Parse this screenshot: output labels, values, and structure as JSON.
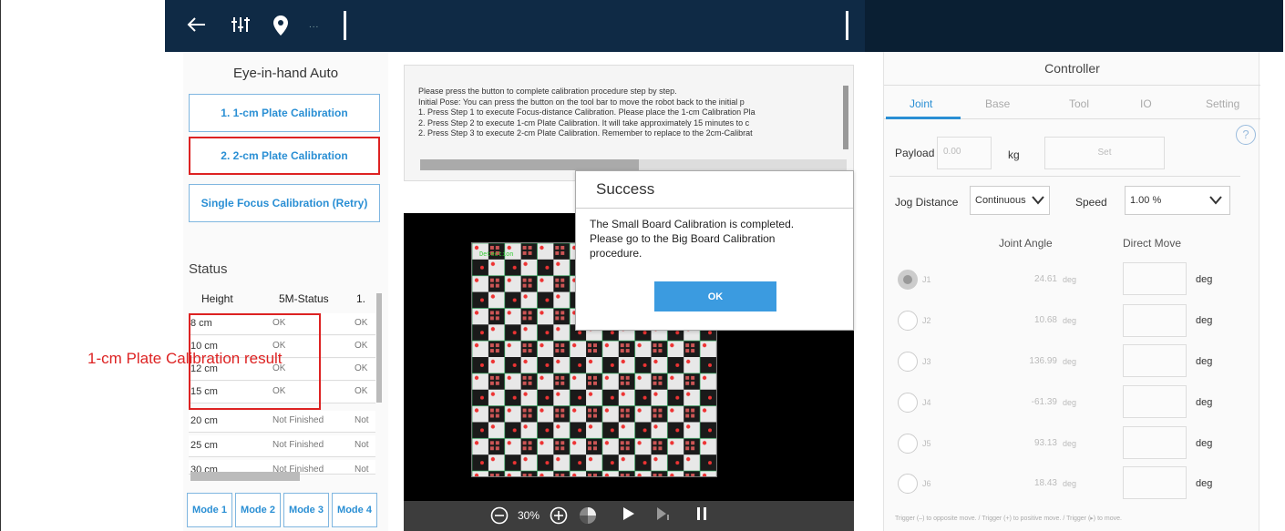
{
  "toolbar": {
    "back_icon": "arrow-left-icon",
    "sliders_icon": "sliders-icon",
    "pin_icon": "location-pin-icon",
    "ellipsis": "..."
  },
  "left": {
    "title": "Eye-in-hand Auto",
    "buttons": [
      "1. 1-cm Plate Calibration",
      "2. 2-cm Plate Calibration",
      "Single Focus Calibration (Retry)"
    ],
    "status_label": "Status",
    "columns": [
      "Height",
      "5M-Status",
      "1."
    ],
    "rows": [
      {
        "height": "8 cm",
        "status": "OK",
        "c3": "OK"
      },
      {
        "height": "10 cm",
        "status": "OK",
        "c3": "OK"
      },
      {
        "height": "12 cm",
        "status": "OK",
        "c3": "OK"
      },
      {
        "height": "15 cm",
        "status": "OK",
        "c3": "OK"
      },
      {
        "height": "20 cm",
        "status": "Not Finished",
        "c3": "Not"
      },
      {
        "height": "25 cm",
        "status": "Not Finished",
        "c3": "Not"
      },
      {
        "height": "30 cm",
        "status": "Not Finished",
        "c3": "Not"
      }
    ],
    "modes": [
      "Mode 1",
      "Mode 2",
      "Mode 3",
      "Mode 4"
    ]
  },
  "annotation": "1-cm Plate Calibration result",
  "instructions": [
    "Please press the button to complete calibration procedure step by step.",
    "Initial Pose: You can press the button on the tool bar to move the robot back to the initial p",
    "1. Press Step 1 to execute Focus-distance Calibration. Please place the 1-cm Calibration Pla",
    "2. Press Step 2 to execute 1-cm Plate Calibration. It will take approximately 15 minutes to c",
    "2. Press Step 3 to execute 2-cm Plate Calibration. Remember to replace to the 2cm-Calibrat"
  ],
  "camera": {
    "overlay_text": "Detection",
    "zoom": "30%"
  },
  "dialog": {
    "title": "Success",
    "message_line1": "The Small Board Calibration is completed.",
    "message_line2": "Please go to the Big Board Calibration",
    "message_line3": "procedure.",
    "ok": "OK"
  },
  "controller": {
    "title": "Controller",
    "tabs": [
      "Joint",
      "Base",
      "Tool",
      "IO",
      "Setting"
    ],
    "help": "?",
    "payload_label": "Payload",
    "payload_value": "0.00",
    "payload_unit": "kg",
    "set_label": "Set",
    "jog_label": "Jog Distance",
    "jog_value": "Continuous",
    "speed_label": "Speed",
    "speed_value": "1.00 %",
    "col_joint": "Joint Angle",
    "col_direct": "Direct Move",
    "joints": [
      {
        "name": "J1",
        "value": "24.61",
        "unit": "deg"
      },
      {
        "name": "J2",
        "value": "10.68",
        "unit": "deg"
      },
      {
        "name": "J3",
        "value": "136.99",
        "unit": "deg"
      },
      {
        "name": "J4",
        "value": "-61.39",
        "unit": "deg"
      },
      {
        "name": "J5",
        "value": "93.13",
        "unit": "deg"
      },
      {
        "name": "J6",
        "value": "18.43",
        "unit": "deg"
      }
    ],
    "deg": "deg",
    "footnote": "Trigger (–) to opposite move.  /  Trigger (+) to positive move.  /  Trigger (▸) to move."
  }
}
